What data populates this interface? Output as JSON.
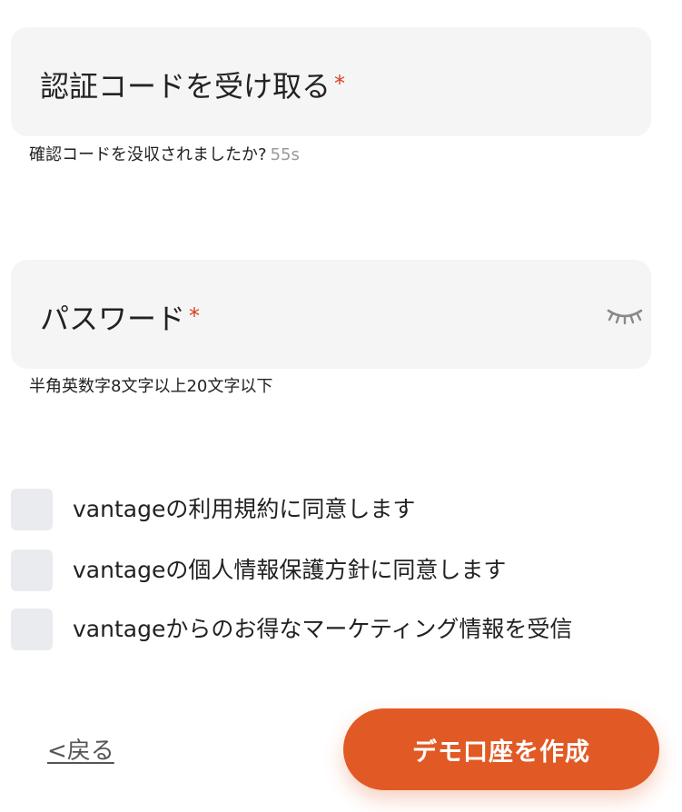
{
  "colors": {
    "accent": "#e15a25",
    "required_mark": "#d9401d",
    "field_background": "#f5f5f5",
    "checkbox_background": "#e9ebef",
    "muted_text": "#999999"
  },
  "verification": {
    "label": "認証コードを受け取る",
    "required_mark": "*",
    "helper_text": "確認コードを没収されましたか?",
    "countdown": "55s"
  },
  "password": {
    "label": "パスワード",
    "required_mark": "*",
    "visibility_icon": "eye-closed-icon",
    "helper_text": "半角英数字8文字以上20文字以下"
  },
  "consents": [
    {
      "label": "vantageの利用規約に同意します",
      "checked": false
    },
    {
      "label": "vantageの個人情報保護方針に同意します",
      "checked": false
    },
    {
      "label": "vantageからのお得なマーケティング情報を受信",
      "checked": false
    }
  ],
  "actions": {
    "back_label": "<戻る",
    "create_label": "デモ口座を作成"
  }
}
